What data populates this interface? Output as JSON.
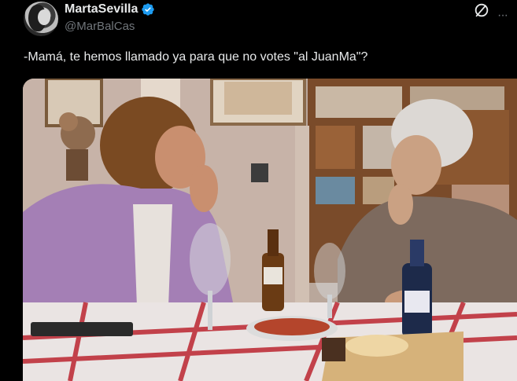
{
  "author": {
    "display_name": "MartaSevilla",
    "handle": "@MarBalCas",
    "verified": true,
    "avatar_icon": "profile-photo-avatar"
  },
  "tweet": {
    "text": "-Mamá, te hemos llamado ya para que no votes \"al JuanMa\"?"
  },
  "icons": {
    "verified": "verified-badge-icon",
    "grok": "grok-icon",
    "more": "more-options-icon",
    "more_glyph": "···"
  },
  "colors": {
    "background": "#000000",
    "text": "#e7e9ea",
    "secondary_text": "#71767b",
    "verified_blue": "#1d9bf0"
  }
}
